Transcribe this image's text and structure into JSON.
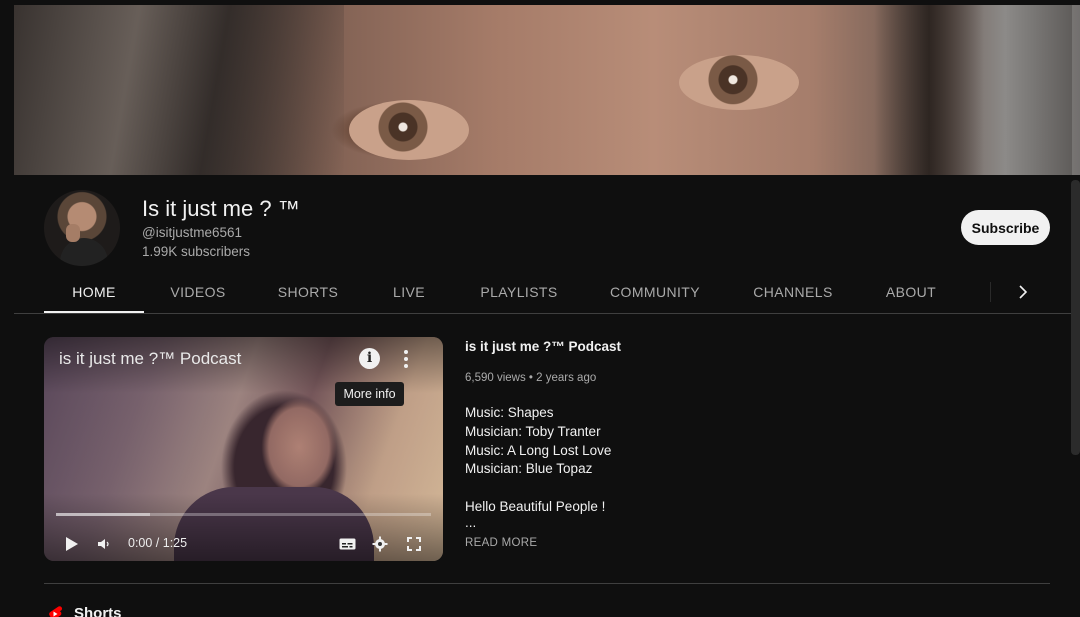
{
  "channel": {
    "title": "Is it just me ? ™",
    "handle": "@isitjustme6561",
    "subscribers": "1.99K subscribers",
    "subscribe_label": "Subscribe"
  },
  "tabs": [
    {
      "label": "HOME",
      "active": true
    },
    {
      "label": "VIDEOS",
      "active": false
    },
    {
      "label": "SHORTS",
      "active": false
    },
    {
      "label": "LIVE",
      "active": false
    },
    {
      "label": "PLAYLISTS",
      "active": false
    },
    {
      "label": "COMMUNITY",
      "active": false
    },
    {
      "label": "CHANNELS",
      "active": false
    },
    {
      "label": "ABOUT",
      "active": false
    }
  ],
  "player": {
    "title": "is it just me ?™ Podcast",
    "tooltip": "More info",
    "time": "0:00 / 1:25",
    "progress_loaded": 0.25
  },
  "featured": {
    "title": "is it just me ?™ Podcast",
    "meta": "6,590 views • 2 years ago",
    "description_lines": [
      "Music: Shapes",
      "Musician: Toby Tranter",
      "Music: A Long Lost Love",
      "Musician: Blue Topaz",
      "",
      "Hello Beautiful People !",
      "..."
    ],
    "read_more": "READ MORE"
  },
  "shelf": {
    "title": "Shorts"
  },
  "colors": {
    "background": "#0f0f0f",
    "text": "#f1f1f1",
    "secondary_text": "#aaaaaa",
    "shorts_red": "#ff0000"
  }
}
